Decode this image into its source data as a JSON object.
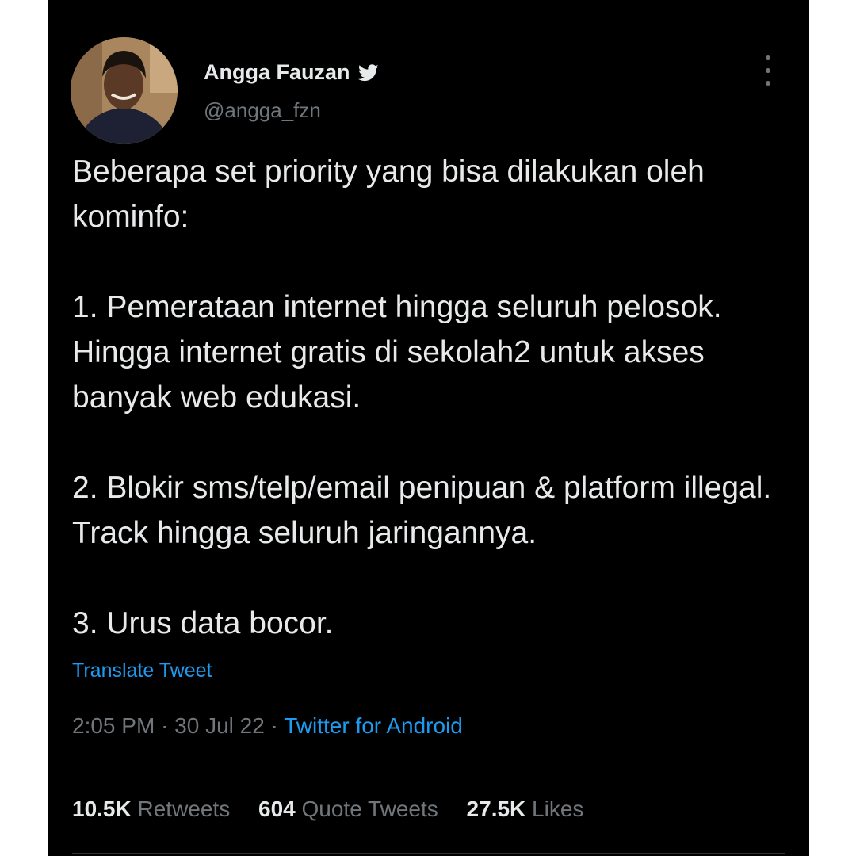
{
  "user": {
    "name": "Angga Fauzan",
    "handle": "@angga_fzn",
    "verified_icon": "twitter-bird-icon"
  },
  "tweet": {
    "text": "Beberapa set priority yang bisa dilakukan oleh kominfo:\n\n1. Pemerataan internet hingga seluruh pelosok. Hingga internet gratis di sekolah2 untuk akses banyak web edukasi.\n\n2. Blokir sms/telp/email penipuan & platform illegal. Track hingga seluruh jaringannya.\n\n3. Urus data bocor.",
    "translate_label": "Translate Tweet"
  },
  "meta": {
    "time": "2:05 PM",
    "sep1": " · ",
    "date": "30 Jul 22",
    "sep2": " · ",
    "source": "Twitter for Android"
  },
  "stats": {
    "retweets_count": "10.5K",
    "retweets_label": "Retweets",
    "quotes_count": "604",
    "quotes_label": "Quote Tweets",
    "likes_count": "27.5K",
    "likes_label": "Likes"
  },
  "colors": {
    "background": "#000000",
    "text_primary": "#e7e9ea",
    "text_secondary": "#71767b",
    "accent": "#1d9bf0"
  }
}
